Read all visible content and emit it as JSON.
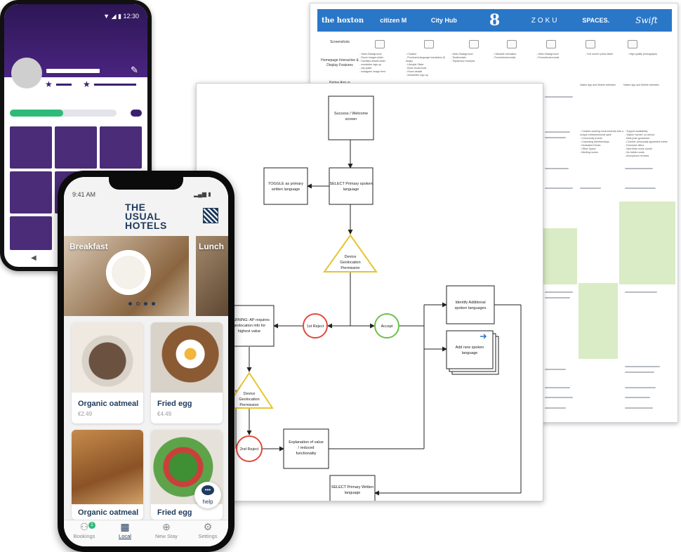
{
  "comparison_table": {
    "brands": [
      "the hoxton",
      "citizen M",
      "City Hub",
      "8",
      "ZOKU",
      "SPACES.",
      "Swift"
    ],
    "row_labels": [
      "Screenshots",
      "Homepage Interactive & Display Features",
      "Native App or"
    ],
    "homepage_features": [
      [
        "- Video Background",
        "- Room images slider",
        "- Facilities details slider",
        "- newsletter sign up",
        "- city guide",
        "- Instagram image feed"
      ],
      [
        "- Chatbot",
        "- Prominent language translation (5 langs)",
        "- Lifestyle Slider",
        "- Book visual tools",
        "- Room details",
        "- Newsletter sign up"
      ],
      [
        "- Video Background",
        "- Testimonials",
        "- Tripadvisor excerpts"
      ],
      [
        "- Clickable animation",
        "- Promotional modal"
      ],
      [
        "- Video Background",
        "- Promotional modal"
      ],
      [
        "- Full screen photo slider"
      ],
      [
        "- High quality photography"
      ]
    ],
    "col_notes": [
      "Native app and Mobile websites",
      "Native app and Mobile websites"
    ],
    "zoku_bullets": [
      "- Creative working environments with a unique entrepreneurial spirit",
      "- Community events",
      "- Coworking Memberships",
      "- Dedicated Desks",
      "- Office Space",
      "- Meeting rooms"
    ],
    "swift_bullets": [
      "- Support availability",
      "- Stylish 'homes' on arrival",
      "- Best price guarantee",
      "- Comfort: personally appointed hotels",
      "- Exclusive offers",
      "- New finds every month",
      "- No hidden costs",
      "- Anonymous reviews"
    ]
  },
  "flowchart": {
    "nodes": {
      "success": "Success / Welcome screen",
      "toggle": "TOGGLE as primary written language",
      "select_spoken": "SELECT Primary spoken language",
      "geo1": "Device Geolocation Permission",
      "warning": "WARNING: AP requires geolocation info for highest value",
      "reject1": "1st Reject",
      "accept": "Accept",
      "identify": "Identify Additional spoken languages",
      "add_lang": "Add new spoken language",
      "geo2": "Device Geolocation Permission",
      "reject2": "2nd Reject",
      "explanation": "Explanation of value / reduced functionality",
      "select_written": "SELECT Primary Written language"
    }
  },
  "android": {
    "status_time": "12:30"
  },
  "iphone": {
    "status_time": "9:41 AM",
    "logo": [
      "THE",
      "USUAL",
      "HOTELS"
    ],
    "carousel": [
      "Breakfast",
      "Lunch"
    ],
    "menu_items": [
      {
        "title": "Organic oatmeal",
        "price": "€2.49"
      },
      {
        "title": "Fried egg",
        "price": "€4.49"
      },
      {
        "title": "Organic oatmeal",
        "price": ""
      },
      {
        "title": "Fried egg",
        "price": ""
      }
    ],
    "help_label": "help",
    "nav": [
      {
        "label": "Bookings",
        "badge": "1"
      },
      {
        "label": "Local"
      },
      {
        "label": "New Stay"
      },
      {
        "label": "Settings"
      }
    ],
    "colors": {
      "navy": "#1e3a5c",
      "accent_green": "#2fba7a"
    }
  }
}
